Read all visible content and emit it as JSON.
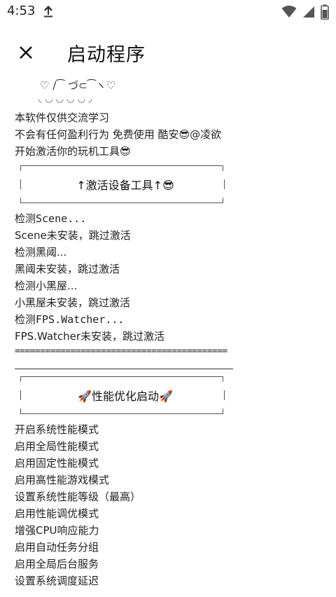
{
  "status_bar": {
    "time": "4:53",
    "icons": [
      "upload-icon",
      "wifi-icon",
      "signal-icon",
      "battery-icon"
    ]
  },
  "app_bar": {
    "title": "启动程序",
    "close_icon": "close-icon"
  },
  "content": {
    "kaomoji_top": "♡ /⁀ づ⊂⁀ヽ♡",
    "kaomoji_bottom": "◟ ◡ ◡ ◡ ◡ ◞",
    "intro": [
      "本软件仅供交流学习",
      "不会有任何盈利行为 免费使用 酷安😎@凌欲",
      "开始激活你的玩机工具😎"
    ],
    "activate_button": "↑激活设备工具↑😎",
    "checks": [
      "检测Scene...",
      "Scene未安装，跳过激活",
      "检测黑阈...",
      "黑阈未安装，跳过激活",
      "检测小黑屋...",
      "小黑屋未安装，跳过激活",
      "检测FPS.Watcher...",
      "FPS.Watcher未安装，跳过激活"
    ],
    "separator": "==========================================",
    "perf_button": "🚀性能优化启动🚀",
    "perf_items": [
      "开启系统性能模式",
      "启用全局性能模式",
      "启用固定性能模式",
      "启用高性能游戏模式",
      "设置系统性能等级（最高）",
      "启用性能调优模式",
      "增强CPU响应能力",
      "启用自动任务分组",
      "启用全局后台服务",
      "设置系统调度延迟"
    ]
  }
}
